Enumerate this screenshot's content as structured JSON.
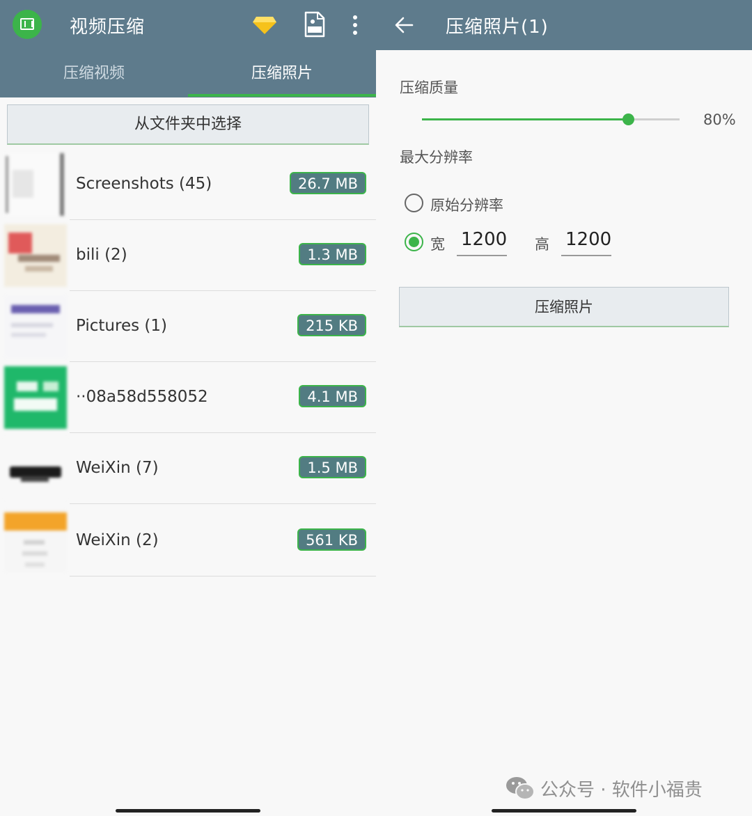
{
  "left": {
    "app_title": "视频压缩",
    "tabs": [
      {
        "label": "压缩视频"
      },
      {
        "label": "压缩照片"
      }
    ],
    "pick_button": "从文件夹中选择",
    "folders": [
      {
        "name": "Screenshots (45)",
        "size": "26.7 MB"
      },
      {
        "name": "bili (2)",
        "size": "1.3 MB"
      },
      {
        "name": "Pictures (1)",
        "size": "215 KB"
      },
      {
        "name": "··08a58d558052",
        "size": "4.1 MB"
      },
      {
        "name": "WeiXin (7)",
        "size": "1.5 MB"
      },
      {
        "name": "WeiXin (2)",
        "size": "561 KB"
      }
    ],
    "icons": [
      "app-logo-icon",
      "diamond-icon",
      "mp3-file-icon",
      "more-vert-icon"
    ]
  },
  "right": {
    "title": "压缩照片(1)",
    "quality_label": "压缩质量",
    "quality_value": 0.8,
    "quality_text": "80%",
    "max_res_label": "最大分辨率",
    "option_original": "原始分辨率",
    "option_custom_width_label": "宽",
    "option_custom_height_label": "高",
    "width_value": "1200",
    "height_value": "1200",
    "selected_option": "custom",
    "compress_button": "压缩照片",
    "icons": [
      "back-arrow-icon"
    ]
  },
  "watermark": "公众号 · 软件小福贵",
  "colors": {
    "appbar": "#5e7b8c",
    "accent": "#3cb44a",
    "size_badge": "#527c82"
  }
}
